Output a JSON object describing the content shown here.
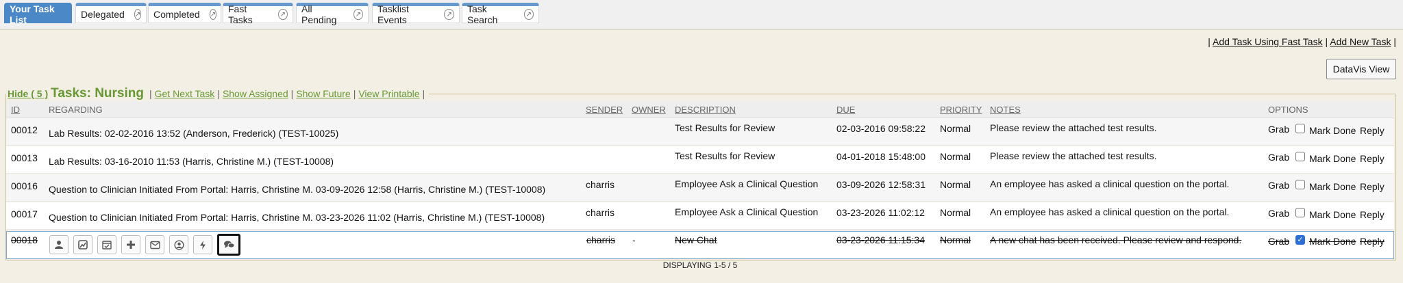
{
  "tabs": [
    {
      "label": "Your Task List",
      "active": true
    },
    {
      "label": "Delegated"
    },
    {
      "label": "Completed"
    },
    {
      "label": "Fast Tasks"
    },
    {
      "label": "All Pending"
    },
    {
      "label": "Tasklist Events"
    },
    {
      "label": "Task Search"
    }
  ],
  "toplinks": {
    "sep": "|",
    "fast": "Add Task Using Fast Task",
    "new": "Add New Task"
  },
  "datavis_label": "DataVis View",
  "panel": {
    "hide": "Hide ( 5 )",
    "title": "Tasks: Nursing",
    "links": [
      "Get Next Task",
      "Show Assigned",
      "Show Future",
      "View Printable"
    ],
    "sep": "|"
  },
  "columns": {
    "id": "ID",
    "regarding": "REGARDING",
    "sender": "SENDER",
    "owner": "OWNER",
    "description": "DESCRIPTION",
    "due": "DUE",
    "priority": "PRIORITY",
    "notes": "NOTES",
    "options": "OPTIONS"
  },
  "option_labels": {
    "grab": "Grab",
    "mark_done": "Mark Done",
    "reply": "Reply"
  },
  "rows": [
    {
      "id": "00012",
      "regarding": "Lab Results: 02-02-2016 13:52 (Anderson, Frederick) (TEST-10025)",
      "sender": "",
      "owner": "",
      "description": "Test Results for Review",
      "due": "02-03-2016 09:58:22",
      "priority": "Normal",
      "notes": "Please review the attached test results.",
      "done": false
    },
    {
      "id": "00013",
      "regarding": "Lab Results: 03-16-2010 11:53 (Harris, Christine M.) (TEST-10008)",
      "sender": "",
      "owner": "",
      "description": "Test Results for Review",
      "due": "04-01-2018 15:48:00",
      "priority": "Normal",
      "notes": "Please review the attached test results.",
      "done": false
    },
    {
      "id": "00016",
      "regarding": "Question to Clinician Initiated From Portal: Harris, Christine M. 03-09-2026 12:58 (Harris, Christine M.) (TEST-10008)",
      "sender": "charris",
      "owner": "",
      "description": "Employee Ask a Clinical Question",
      "due": "03-09-2026 12:58:31",
      "priority": "Normal",
      "notes": "An employee has asked a clinical question on the portal.",
      "done": false
    },
    {
      "id": "00017",
      "regarding": "Question to Clinician Initiated From Portal: Harris, Christine M. 03-23-2026 11:02 (Harris, Christine M.) (TEST-10008)",
      "sender": "charris",
      "owner": "",
      "description": "Employee Ask a Clinical Question",
      "due": "03-23-2026 11:02:12",
      "priority": "Normal",
      "notes": "An employee has asked a clinical question on the portal.",
      "done": false
    },
    {
      "id": "00018",
      "regarding": "",
      "sender": "charris",
      "owner": "-",
      "description": "New Chat",
      "due": "03-23-2026 11:15:34",
      "priority": "Normal",
      "notes": "A new chat has been received. Please review and respond.",
      "done": true
    }
  ],
  "row_icons": [
    "user-icon",
    "image-icon",
    "calendar-check-icon",
    "plus-icon",
    "envelope-icon",
    "user-circle-icon",
    "bolt-icon",
    "chat-icon"
  ],
  "footer": "DISPLAYING 1-5 / 5",
  "colors": {
    "tab_active": "#4b88c8",
    "tab_accent": "#6699cc",
    "section_green": "#669933",
    "background": "#f3efe4"
  }
}
